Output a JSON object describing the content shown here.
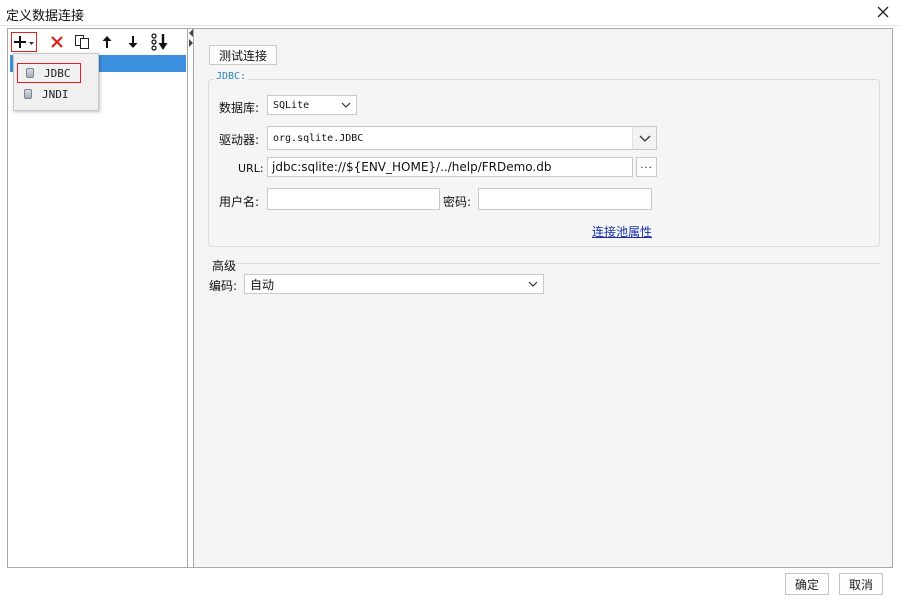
{
  "window": {
    "title": "定义数据连接"
  },
  "popup": {
    "items": [
      "JDBC",
      "JNDI"
    ]
  },
  "right": {
    "test_button": "测试连接",
    "group_label": "JDBC:",
    "database_label": "数据库:",
    "database_value": "SQLite",
    "driver_label": "驱动器:",
    "driver_value": "org.sqlite.JDBC",
    "url_label": "URL:",
    "url_value": "jdbc:sqlite://${ENV_HOME}/../help/FRDemo.db",
    "url_browse": "...",
    "username_label": "用户名:",
    "password_label": "密码:",
    "pool_link": "连接池属性",
    "advanced_label": "高级",
    "encoding_label": "编码:",
    "encoding_value": "自动"
  },
  "footer": {
    "ok": "确定",
    "cancel": "取消"
  },
  "colors": {
    "selection": "#3c8ede",
    "highlight_border": "#e02020",
    "link": "#1a2fa6",
    "legend": "#2b86b8"
  }
}
